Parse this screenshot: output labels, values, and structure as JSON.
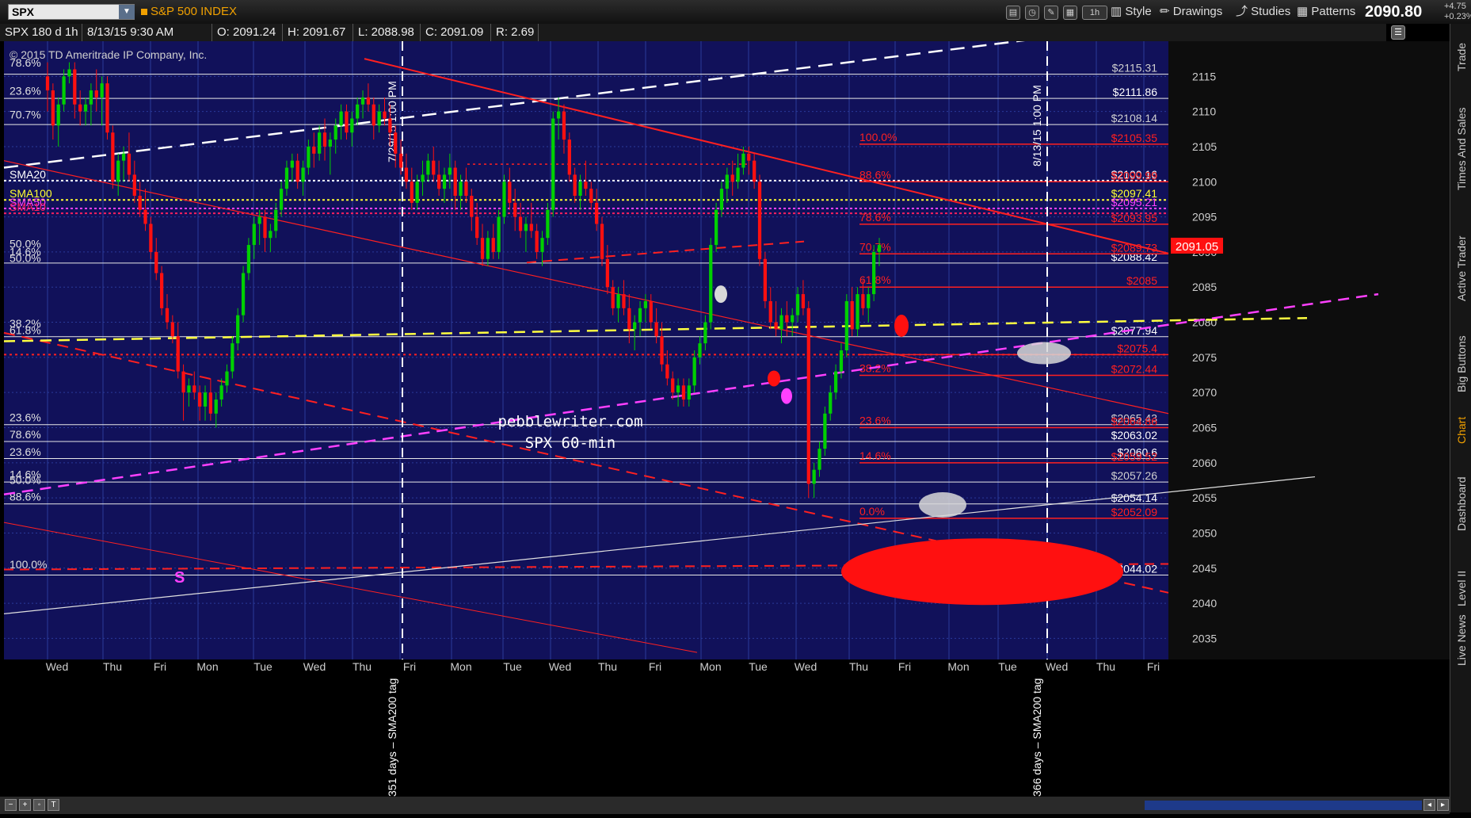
{
  "toolbar": {
    "symbol": "SPX",
    "symbol_name": "S&P 500 INDEX",
    "style_label": "Style",
    "drawings_label": "Drawings",
    "studies_label": "Studies",
    "patterns_label": "Patterns",
    "timeframe_label": "1h",
    "last_price": "2090.80",
    "change_points": "+4.75",
    "change_percent": "+0.23%"
  },
  "infobar": {
    "chart_spec": "SPX 180 d 1h",
    "datetime": "8/13/15 9:30 AM",
    "open": "O: 2091.24",
    "high": "H: 2091.67",
    "low": "L: 2088.98",
    "close": "C: 2091.09",
    "range": "R: 2.69"
  },
  "sidebar": {
    "tabs": [
      "Trade",
      "Times And Sales",
      "Active Trader",
      "Big Buttons",
      "Chart",
      "Dashboard",
      "Level II",
      "Live News"
    ]
  },
  "colors": {
    "chart_bg": "#11115a",
    "up_candle": "#00d000",
    "down_candle": "#ff1010",
    "fib_red": "#ff2020",
    "sma20": "#ffffff",
    "sma100": "#ffff30",
    "sma50": "#ff40ff",
    "sma10": "#ff2060",
    "trend_yellow": "#ffff40",
    "trend_magenta": "#ff40ff",
    "grid": "#2a3a9a",
    "price_tag": "#ff1010"
  },
  "chart_data": {
    "type": "candlestick",
    "timeframe": "60-min",
    "ylim": [
      2032,
      2120
    ],
    "y_ticks": [
      2035,
      2040,
      2045,
      2050,
      2055,
      2060,
      2065,
      2070,
      2075,
      2080,
      2085,
      2090,
      2095,
      2100,
      2105,
      2110,
      2115
    ],
    "x_tick_labels": [
      "Wed",
      "Thu",
      "Fri",
      "Mon",
      "Tue",
      "Wed",
      "Thu",
      "Fri",
      "Mon",
      "Tue",
      "Wed",
      "Thu",
      "Fri",
      "Mon",
      "Tue",
      "Wed",
      "Thu",
      "Fri",
      "Mon",
      "Tue",
      "Wed",
      "Thu",
      "Fri"
    ],
    "copyright": "© 2015 TD Ameritrade IP Company, Inc.",
    "watermark": [
      "pebblewriter.com",
      "SPX 60-min"
    ],
    "current_price_tag": "2091.05",
    "white_hlines": [
      {
        "price": 2115.31,
        "label": "$2115.31",
        "label_color": "#cfcfcf"
      },
      {
        "price": 2111.86,
        "label": "$2111.86",
        "label_color": "#ffffff"
      },
      {
        "price": 2108.14,
        "label": "$2108.14",
        "label_color": "#cfcfcf"
      },
      {
        "price": 2088.42,
        "label": "$2088.42",
        "label_color": "#ffffff"
      },
      {
        "price": 2077.94,
        "label": "$2077.94",
        "label_color": "#ffffff"
      },
      {
        "price": 2065.43,
        "label": "$2065.43",
        "label_color": "#cfcfcf"
      },
      {
        "price": 2063.02,
        "label": "$2063.02",
        "label_color": "#ffffff"
      },
      {
        "price": 2060.6,
        "label": "$2060.6",
        "label_color": "#ffffff"
      },
      {
        "price": 2057.26,
        "label": "$2057.26",
        "label_color": "#cfcfcf"
      },
      {
        "price": 2054.14,
        "label": "$2054.14",
        "label_color": "#ffffff"
      },
      {
        "price": 2044.02,
        "label": "$2044.02",
        "label_color": "#ffffff"
      }
    ],
    "sma_lines": [
      {
        "name": "SMA20",
        "price": 2100.16,
        "label": "$2100.16",
        "color": "#ffffff"
      },
      {
        "name": "SMA100",
        "price": 2097.41,
        "label": "$2097.41",
        "color": "#ffff30"
      },
      {
        "name": "SMA50",
        "price": 2096.2,
        "label": "$2095.21",
        "color": "#ff40ff"
      },
      {
        "name": "SMA10",
        "price": 2095.5,
        "label": "",
        "color": "#ff2060"
      }
    ],
    "red_fib_lines": [
      {
        "price": 2105.35,
        "label": "$2105.35",
        "level": "100.0%"
      },
      {
        "price": 2100.0,
        "label": "$2099.99",
        "level": "88.6%"
      },
      {
        "price": 2093.95,
        "label": "$2093.95",
        "level": "78.6%"
      },
      {
        "price": 2089.73,
        "label": "$2089.73",
        "level": "70.7%"
      },
      {
        "price": 2085.0,
        "label": "$2085",
        "level": "61.8%"
      },
      {
        "price": 2075.4,
        "label": "$2075.4",
        "level": ""
      },
      {
        "price": 2072.44,
        "label": "$2072.44",
        "level": "38.2%"
      },
      {
        "price": 2065.0,
        "label": "$2064.86",
        "level": "23.6%"
      },
      {
        "price": 2060.0,
        "label": "$2059.52",
        "level": "14.6%"
      },
      {
        "price": 2052.09,
        "label": "$2052.09",
        "level": "0.0%"
      }
    ],
    "left_level_labels": [
      {
        "price": 2116.4,
        "label": "78.6%"
      },
      {
        "price": 2112.4,
        "label": "23.6%"
      },
      {
        "price": 2109.0,
        "label": "70.7%"
      },
      {
        "price": 2090.6,
        "label": "50.0%"
      },
      {
        "price": 2089.5,
        "label": "14.6%"
      },
      {
        "price": 2088.6,
        "label": "50.0%"
      },
      {
        "price": 2079.3,
        "label": "38.2%"
      },
      {
        "price": 2078.3,
        "label": "61.8%"
      },
      {
        "price": 2065.9,
        "label": "23.6%"
      },
      {
        "price": 2063.5,
        "label": "78.6%"
      },
      {
        "price": 2061.0,
        "label": "23.6%"
      },
      {
        "price": 2057.8,
        "label": "14.6%"
      },
      {
        "price": 2057.0,
        "label": "50.0%"
      },
      {
        "price": 2054.6,
        "label": "88.6%"
      },
      {
        "price": 2045.0,
        "label": "100.0%"
      }
    ],
    "vertical_markers": [
      {
        "time_label": "7/29/15 1:00 PM",
        "note": "351 days – SMA200 tag",
        "bar_index": 70
      },
      {
        "time_label": "8/13/15 1:00 PM",
        "note": "366 days – SMA200 tag",
        "bar_index": 183
      }
    ],
    "annotation_s": "S",
    "candles_ohlc": [
      [
        2115,
        2117,
        2110,
        2113
      ],
      [
        2113,
        2114,
        2106,
        2108
      ],
      [
        2108,
        2112,
        2105,
        2111
      ],
      [
        2111,
        2116,
        2110,
        2115
      ],
      [
        2115,
        2117,
        2114,
        2116
      ],
      [
        2116,
        2117,
        2109,
        2111
      ],
      [
        2111,
        2113,
        2108,
        2110
      ],
      [
        2110,
        2112,
        2108,
        2111
      ],
      [
        2111,
        2114,
        2108,
        2113
      ],
      [
        2113,
        2116,
        2110,
        2112
      ],
      [
        2112,
        2115,
        2108,
        2114
      ],
      [
        2114,
        2115,
        2106,
        2107
      ],
      [
        2107,
        2108,
        2099,
        2100
      ],
      [
        2100,
        2104,
        2098,
        2103
      ],
      [
        2103,
        2105,
        2100,
        2104
      ],
      [
        2104,
        2107,
        2100,
        2101
      ],
      [
        2101,
        2103,
        2097,
        2098
      ],
      [
        2098,
        2100,
        2095,
        2096
      ],
      [
        2096,
        2099,
        2093,
        2094
      ],
      [
        2094,
        2095,
        2089,
        2090
      ],
      [
        2090,
        2092,
        2086,
        2087
      ],
      [
        2087,
        2088,
        2081,
        2082
      ],
      [
        2082,
        2084,
        2079,
        2080
      ],
      [
        2080,
        2081,
        2077,
        2078
      ],
      [
        2078,
        2080,
        2072,
        2073
      ],
      [
        2073,
        2074,
        2066,
        2070
      ],
      [
        2070,
        2072,
        2068,
        2071
      ],
      [
        2071,
        2073,
        2069,
        2070
      ],
      [
        2070,
        2071,
        2066,
        2068
      ],
      [
        2068,
        2071,
        2066,
        2070
      ],
      [
        2070,
        2072,
        2066,
        2067
      ],
      [
        2067,
        2070,
        2065,
        2069
      ],
      [
        2069,
        2072,
        2068,
        2071
      ],
      [
        2071,
        2074,
        2070,
        2073
      ],
      [
        2073,
        2078,
        2072,
        2077
      ],
      [
        2077,
        2082,
        2076,
        2081
      ],
      [
        2081,
        2088,
        2080,
        2087
      ],
      [
        2087,
        2092,
        2086,
        2091
      ],
      [
        2091,
        2095,
        2089,
        2094
      ],
      [
        2094,
        2096,
        2091,
        2095
      ],
      [
        2095,
        2096,
        2090,
        2092
      ],
      [
        2092,
        2094,
        2090,
        2093
      ],
      [
        2093,
        2097,
        2092,
        2096
      ],
      [
        2096,
        2100,
        2095,
        2099
      ],
      [
        2099,
        2103,
        2098,
        2102
      ],
      [
        2102,
        2104,
        2100,
        2103
      ],
      [
        2103,
        2104,
        2099,
        2100
      ],
      [
        2100,
        2103,
        2098,
        2102
      ],
      [
        2102,
        2106,
        2101,
        2105
      ],
      [
        2105,
        2107,
        2102,
        2104
      ],
      [
        2104,
        2108,
        2103,
        2107
      ],
      [
        2107,
        2109,
        2103,
        2105
      ],
      [
        2105,
        2107,
        2101,
        2106
      ],
      [
        2106,
        2109,
        2104,
        2108
      ],
      [
        2108,
        2111,
        2106,
        2110
      ],
      [
        2110,
        2111,
        2106,
        2107
      ],
      [
        2107,
        2110,
        2105,
        2109
      ],
      [
        2109,
        2112,
        2108,
        2111
      ],
      [
        2111,
        2113,
        2109,
        2112
      ],
      [
        2112,
        2114,
        2110,
        2111
      ],
      [
        2111,
        2112,
        2106,
        2108
      ],
      [
        2108,
        2111,
        2107,
        2110
      ],
      [
        2110,
        2112,
        2108,
        2109
      ],
      [
        2109,
        2111,
        2105,
        2107
      ],
      [
        2107,
        2108,
        2102,
        2104
      ],
      [
        2104,
        2106,
        2101,
        2102
      ],
      [
        2102,
        2104,
        2099,
        2100
      ],
      [
        2100,
        2102,
        2096,
        2097
      ],
      [
        2097,
        2101,
        2096,
        2100
      ],
      [
        2100,
        2103,
        2098,
        2101
      ],
      [
        2101,
        2104,
        2100,
        2103
      ],
      [
        2103,
        2105,
        2100,
        2101
      ],
      [
        2101,
        2103,
        2098,
        2099
      ],
      [
        2099,
        2102,
        2097,
        2101
      ],
      [
        2101,
        2104,
        2099,
        2102
      ],
      [
        2102,
        2103,
        2096,
        2098
      ],
      [
        2098,
        2101,
        2096,
        2100
      ],
      [
        2100,
        2102,
        2097,
        2098
      ],
      [
        2098,
        2099,
        2093,
        2095
      ],
      [
        2095,
        2097,
        2091,
        2092
      ],
      [
        2092,
        2094,
        2088,
        2089
      ],
      [
        2089,
        2093,
        2088,
        2092
      ],
      [
        2092,
        2094,
        2089,
        2090
      ],
      [
        2090,
        2096,
        2089,
        2095
      ],
      [
        2095,
        2101,
        2094,
        2100
      ],
      [
        2100,
        2102,
        2096,
        2097
      ],
      [
        2097,
        2099,
        2093,
        2095
      ],
      [
        2095,
        2097,
        2092,
        2093
      ],
      [
        2093,
        2095,
        2090,
        2094
      ],
      [
        2094,
        2097,
        2092,
        2093
      ],
      [
        2093,
        2094,
        2089,
        2090
      ],
      [
        2090,
        2093,
        2088,
        2092
      ],
      [
        2092,
        2097,
        2091,
        2096
      ],
      [
        2096,
        2110,
        2095,
        2109
      ],
      [
        2109,
        2112,
        2106,
        2110
      ],
      [
        2110,
        2111,
        2104,
        2106
      ],
      [
        2106,
        2107,
        2100,
        2101
      ],
      [
        2101,
        2102,
        2097,
        2098
      ],
      [
        2098,
        2101,
        2096,
        2100
      ],
      [
        2100,
        2103,
        2098,
        2099
      ],
      [
        2099,
        2100,
        2096,
        2097
      ],
      [
        2097,
        2099,
        2093,
        2094
      ],
      [
        2094,
        2095,
        2088,
        2089
      ],
      [
        2089,
        2091,
        2084,
        2085
      ],
      [
        2085,
        2086,
        2081,
        2082
      ],
      [
        2082,
        2085,
        2080,
        2084
      ],
      [
        2084,
        2086,
        2081,
        2082
      ],
      [
        2082,
        2084,
        2077,
        2079
      ],
      [
        2079,
        2081,
        2076,
        2080
      ],
      [
        2080,
        2083,
        2078,
        2082
      ],
      [
        2082,
        2084,
        2080,
        2083
      ],
      [
        2083,
        2084,
        2079,
        2080
      ],
      [
        2080,
        2082,
        2077,
        2078
      ],
      [
        2078,
        2080,
        2073,
        2074
      ],
      [
        2074,
        2076,
        2071,
        2072
      ],
      [
        2072,
        2073,
        2069,
        2070
      ],
      [
        2070,
        2072,
        2068,
        2071
      ],
      [
        2071,
        2072,
        2068,
        2069
      ],
      [
        2069,
        2072,
        2068,
        2071
      ],
      [
        2071,
        2076,
        2070,
        2075
      ],
      [
        2075,
        2078,
        2074,
        2077
      ],
      [
        2077,
        2081,
        2076,
        2080
      ],
      [
        2080,
        2092,
        2079,
        2091
      ],
      [
        2091,
        2097,
        2090,
        2096
      ],
      [
        2096,
        2100,
        2095,
        2099
      ],
      [
        2099,
        2102,
        2097,
        2101
      ],
      [
        2101,
        2103,
        2098,
        2100
      ],
      [
        2100,
        2104,
        2099,
        2102
      ],
      [
        2102,
        2105,
        2101,
        2104
      ],
      [
        2104,
        2105,
        2101,
        2103
      ],
      [
        2103,
        2104,
        2099,
        2100
      ],
      [
        2100,
        2101,
        2088,
        2089
      ],
      [
        2089,
        2090,
        2082,
        2083
      ],
      [
        2083,
        2085,
        2079,
        2080
      ],
      [
        2080,
        2083,
        2078,
        2079
      ],
      [
        2079,
        2082,
        2077,
        2081
      ],
      [
        2081,
        2083,
        2078,
        2080
      ],
      [
        2080,
        2082,
        2078,
        2081
      ],
      [
        2081,
        2085,
        2080,
        2084
      ],
      [
        2084,
        2086,
        2081,
        2082
      ],
      [
        2082,
        2083,
        2055,
        2057
      ],
      [
        2057,
        2060,
        2055,
        2059
      ],
      [
        2059,
        2063,
        2058,
        2062
      ],
      [
        2062,
        2068,
        2061,
        2067
      ],
      [
        2067,
        2071,
        2066,
        2070
      ],
      [
        2070,
        2074,
        2069,
        2073
      ],
      [
        2073,
        2077,
        2072,
        2076
      ],
      [
        2076,
        2084,
        2075,
        2083
      ],
      [
        2083,
        2085,
        2078,
        2079
      ],
      [
        2079,
        2085,
        2078,
        2084
      ],
      [
        2084,
        2086,
        2081,
        2082
      ],
      [
        2082,
        2085,
        2080,
        2084
      ],
      [
        2084,
        2091,
        2083,
        2090
      ],
      [
        2090,
        2092,
        2088,
        2091
      ]
    ]
  }
}
